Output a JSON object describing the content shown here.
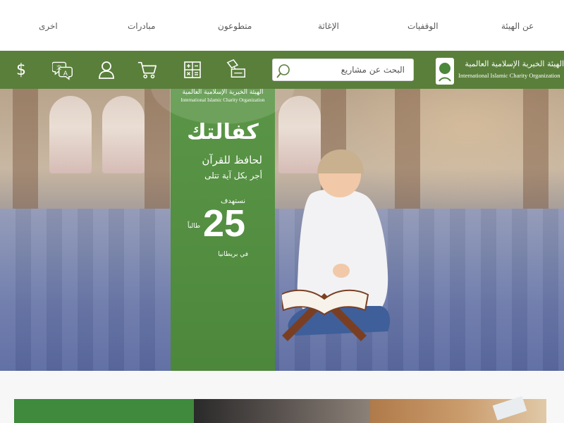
{
  "top_nav": {
    "items": [
      {
        "label": "عن الهيئة"
      },
      {
        "label": "الوقفيات"
      },
      {
        "label": "الإغاثة"
      },
      {
        "label": "متطوعون"
      },
      {
        "label": "مبادرات"
      },
      {
        "label": "اخرى"
      }
    ]
  },
  "header": {
    "search": {
      "placeholder": "البحث عن مشاريع"
    },
    "logo": {
      "arabic": "الهيئة الخيرية الإسلامية العالمية",
      "english": "International Islamic Charity Organization"
    },
    "icons": [
      "currency-icon",
      "language-icon",
      "user-icon",
      "cart-icon",
      "calculator-icon",
      "donate-icon"
    ],
    "currency_symbol": "$"
  },
  "hero": {
    "promo": {
      "org_arabic": "الهيئة الخيرية الإسلامية العالمية",
      "org_english": "International Islamic Charity Organization",
      "headline": "كفالتك",
      "line1": "لحافظ للقرآن",
      "line2": "أجر بكل آية تتلى",
      "target_label": "نستهدف",
      "target_number": "25",
      "target_unit": "طالباً",
      "place": "في بريطانيا"
    }
  },
  "colors": {
    "brand_green": "#5a7f3b",
    "promo_green": "#4f8a3f",
    "nav_text": "#5a5a5a"
  }
}
